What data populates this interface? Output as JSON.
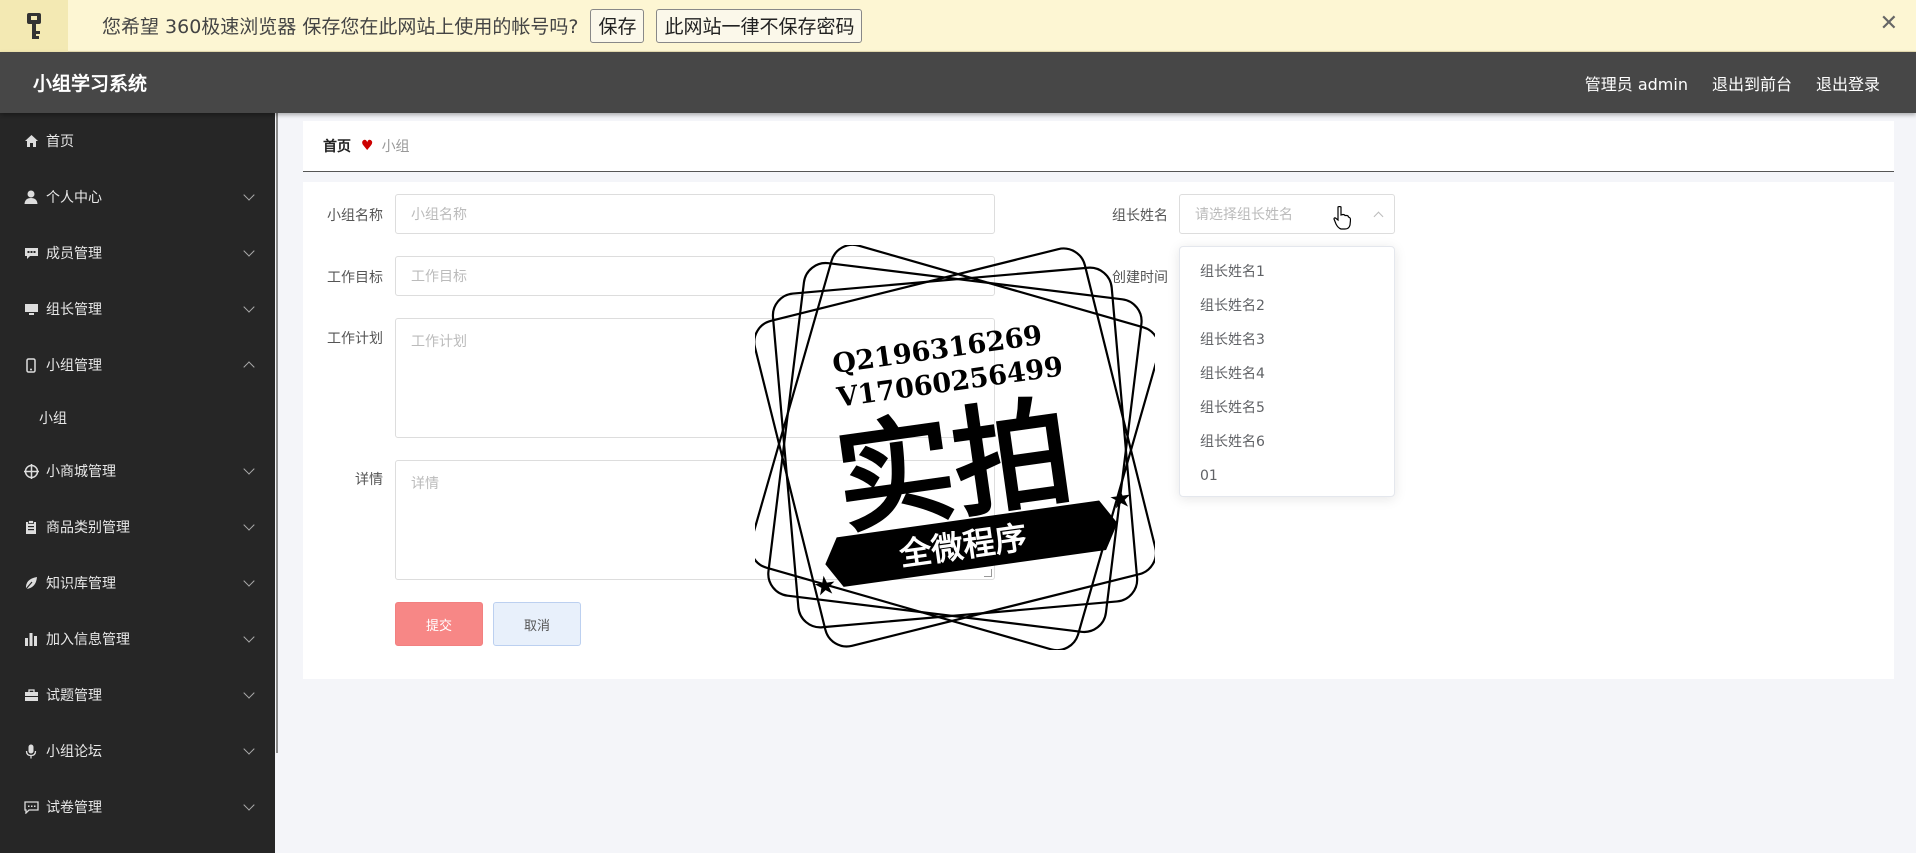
{
  "password_bar": {
    "message": "您希望 360极速浏览器 保存您在此网站上使用的帐号吗?",
    "save_label": "保存",
    "never_label": "此网站一律不保存密码",
    "close_symbol": "✕"
  },
  "header": {
    "title": "小组学习系统",
    "user": "管理员 admin",
    "front_link": "退出到前台",
    "logout_link": "退出登录"
  },
  "sidebar": {
    "items": [
      {
        "label": "首页",
        "icon": "home-icon"
      },
      {
        "label": "个人中心",
        "icon": "user-icon"
      },
      {
        "label": "成员管理",
        "icon": "chat-icon"
      },
      {
        "label": "组长管理",
        "icon": "monitor-icon"
      },
      {
        "label": "小组管理",
        "icon": "phone-icon"
      },
      {
        "label": "小商城管理",
        "icon": "target-icon"
      },
      {
        "label": "商品类别管理",
        "icon": "clipboard-icon"
      },
      {
        "label": "知识库管理",
        "icon": "leaf-icon"
      },
      {
        "label": "加入信息管理",
        "icon": "bar-chart-icon"
      },
      {
        "label": "试题管理",
        "icon": "briefcase-icon"
      },
      {
        "label": "小组论坛",
        "icon": "mic-icon"
      },
      {
        "label": "试卷管理",
        "icon": "message-icon"
      }
    ],
    "sub_item": "小组"
  },
  "breadcrumb": {
    "home": "首页",
    "current": "小组"
  },
  "form": {
    "group_name_label": "小组名称",
    "group_name_placeholder": "小组名称",
    "goal_label": "工作目标",
    "goal_placeholder": "工作目标",
    "plan_label": "工作计划",
    "plan_placeholder": "工作计划",
    "detail_label": "详情",
    "detail_placeholder": "详情",
    "leader_label": "组长姓名",
    "leader_placeholder": "请选择组长姓名",
    "created_label": "创建时间",
    "submit_label": "提交",
    "cancel_label": "取消"
  },
  "dropdown": {
    "options": [
      "组长姓名1",
      "组长姓名2",
      "组长姓名3",
      "组长姓名4",
      "组长姓名5",
      "组长姓名6",
      "01"
    ]
  },
  "stamp": {
    "line1": "Q2196316269",
    "line2": "V17060256499",
    "big": "实拍",
    "banner": "全微程序"
  },
  "colors": {
    "header_bg": "#474747",
    "sidebar_bg": "#262626",
    "submit_bg": "#f78786",
    "cancel_bg": "#e8f0fb"
  }
}
